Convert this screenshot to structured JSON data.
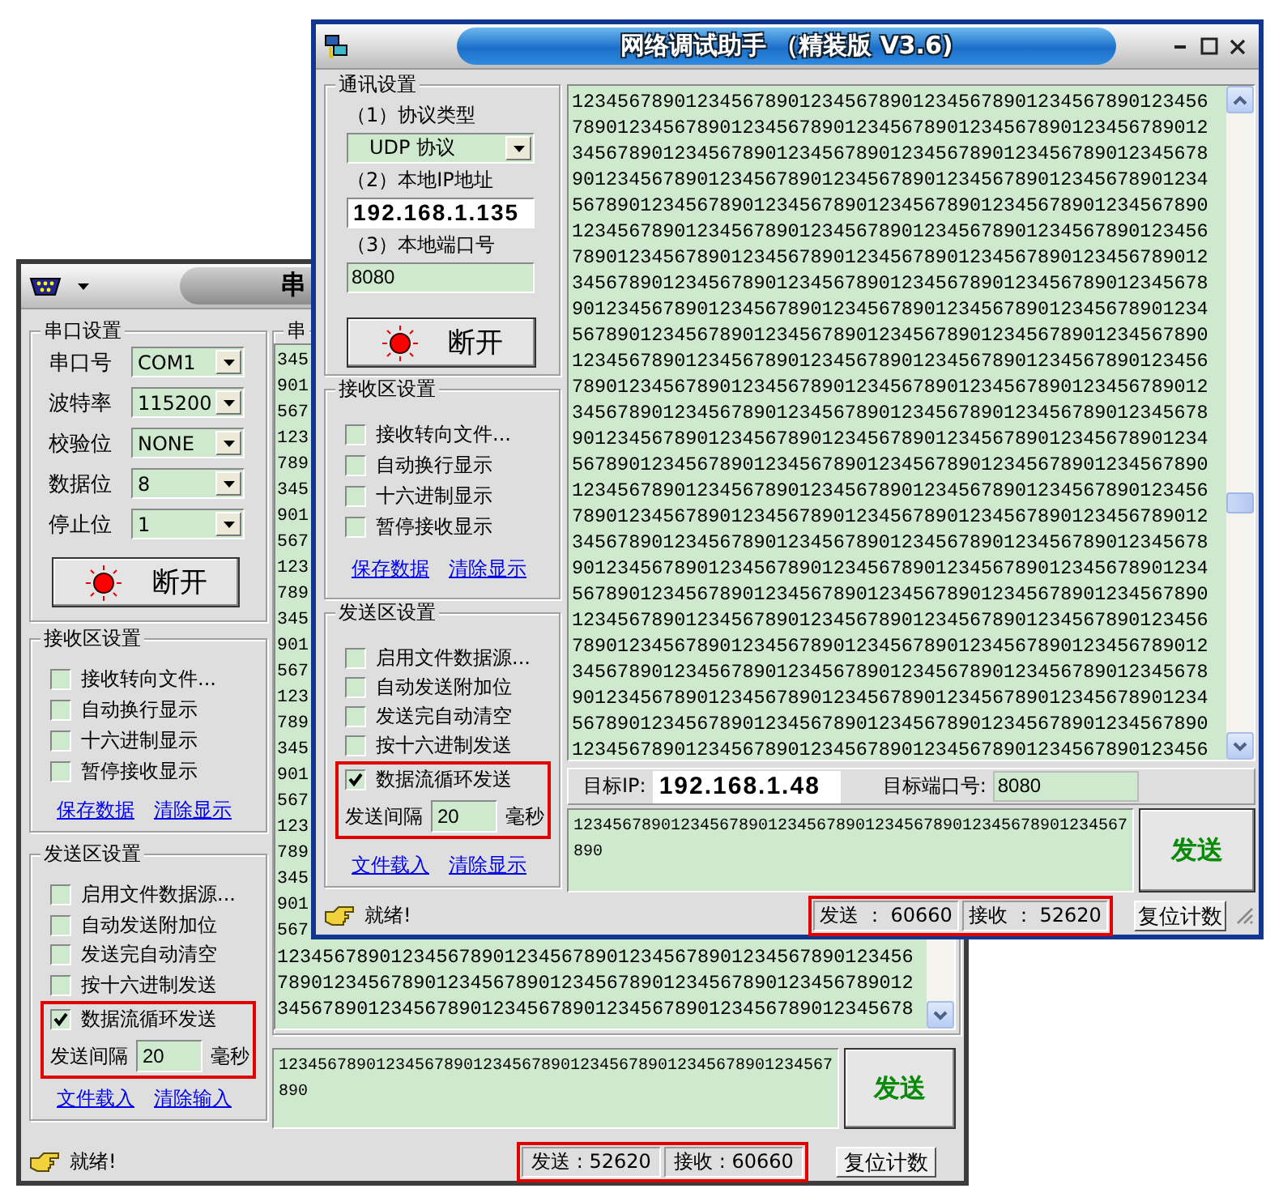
{
  "serial_window": {
    "title": "串",
    "settings_group": {
      "title": "串口设置",
      "items": [
        {
          "kind": "labeled_combo",
          "label": "串口号",
          "value": "COM1"
        },
        {
          "kind": "labeled_combo",
          "label": "波特率",
          "value": "115200"
        },
        {
          "kind": "labeled_combo",
          "label": "校验位",
          "value": "NONE"
        },
        {
          "kind": "labeled_combo",
          "label": "数据位",
          "value": "8"
        },
        {
          "kind": "labeled_combo",
          "label": "停止位",
          "value": "1"
        }
      ],
      "button": "断开"
    },
    "receive_group": {
      "title": "接收区设置",
      "options": [
        {
          "label": "接收转向文件...",
          "checked": false
        },
        {
          "label": "自动换行显示",
          "checked": false
        },
        {
          "label": "十六进制显示",
          "checked": false
        },
        {
          "label": "暂停接收显示",
          "checked": false
        }
      ],
      "links": [
        "保存数据",
        "清除显示"
      ]
    },
    "send_group": {
      "title": "发送区设置",
      "options": [
        {
          "label": "启用文件数据源...",
          "checked": false
        },
        {
          "label": "自动发送附加位",
          "checked": false
        },
        {
          "label": "发送完自动清空",
          "checked": false
        },
        {
          "label": "按十六进制发送",
          "checked": false
        }
      ],
      "loop_box": {
        "highlighted": true,
        "option": {
          "label": "数据流循环发送",
          "checked": true
        },
        "interval": {
          "label": "发送间隔",
          "value": "20",
          "unit": "毫秒"
        }
      },
      "links": [
        "文件载入",
        "清除输入"
      ]
    },
    "receive_panel": {
      "title": "串",
      "clipped_lines": [
        "345",
        "901",
        "567",
        "123",
        "789",
        "345",
        "901",
        "567",
        "123",
        "789",
        "345",
        "901",
        "567",
        "123",
        "789",
        "345",
        "901",
        "567",
        "123",
        "789",
        "345",
        "901",
        "567"
      ],
      "lines": [
        "12345678901234567890123456789012345678901234567890123456",
        "78901234567890123456789012345678901234567890123456789012",
        "34567890123456789012345678901234567890123456789012345678"
      ]
    },
    "send_input": "123456789012345678901234567890123456789012345678901234567890",
    "send_button": "发送",
    "status": "就绪!",
    "counters": {
      "highlighted": true,
      "items": [
        "发送 : 52620",
        "接收 : 60660"
      ]
    },
    "reset_button": "复位计数"
  },
  "network_window": {
    "title": "网络调试助手 （精装版 V3.6)",
    "settings_group": {
      "title": "通讯设置",
      "items": [
        {
          "kind": "caption",
          "text": "（1）协议类型"
        },
        {
          "kind": "combo",
          "value": "UDP 协议"
        },
        {
          "kind": "caption",
          "text": "（2）本地IP地址"
        },
        {
          "kind": "ip",
          "value": "192.168.1.135"
        },
        {
          "kind": "caption",
          "text": "（3）本地端口号"
        },
        {
          "kind": "field",
          "value": "8080"
        }
      ],
      "button": "断开"
    },
    "receive_group": {
      "title": "接收区设置",
      "options": [
        {
          "label": "接收转向文件...",
          "checked": false
        },
        {
          "label": "自动换行显示",
          "checked": false
        },
        {
          "label": "十六进制显示",
          "checked": false
        },
        {
          "label": "暂停接收显示",
          "checked": false
        }
      ],
      "links": [
        "保存数据",
        "清除显示"
      ]
    },
    "send_group": {
      "title": "发送区设置",
      "options": [
        {
          "label": "启用文件数据源...",
          "checked": false
        },
        {
          "label": "自动发送附加位",
          "checked": false
        },
        {
          "label": "发送完自动清空",
          "checked": false
        },
        {
          "label": "按十六进制发送",
          "checked": false
        }
      ],
      "loop_box": {
        "highlighted": true,
        "option": {
          "label": "数据流循环发送",
          "checked": true
        },
        "interval": {
          "label": "发送间隔",
          "value": "20",
          "unit": "毫秒"
        }
      },
      "links": [
        "文件载入",
        "清除显示"
      ]
    },
    "receive_panel": {
      "lines": [
        "12345678901234567890123456789012345678901234567890123456",
        "78901234567890123456789012345678901234567890123456789012",
        "34567890123456789012345678901234567890123456789012345678",
        "90123456789012345678901234567890123456789012345678901234",
        "56789012345678901234567890123456789012345678901234567890",
        "12345678901234567890123456789012345678901234567890123456",
        "78901234567890123456789012345678901234567890123456789012",
        "34567890123456789012345678901234567890123456789012345678",
        "90123456789012345678901234567890123456789012345678901234",
        "56789012345678901234567890123456789012345678901234567890",
        "12345678901234567890123456789012345678901234567890123456",
        "78901234567890123456789012345678901234567890123456789012",
        "34567890123456789012345678901234567890123456789012345678",
        "90123456789012345678901234567890123456789012345678901234",
        "56789012345678901234567890123456789012345678901234567890",
        "12345678901234567890123456789012345678901234567890123456",
        "78901234567890123456789012345678901234567890123456789012",
        "34567890123456789012345678901234567890123456789012345678",
        "90123456789012345678901234567890123456789012345678901234",
        "56789012345678901234567890123456789012345678901234567890",
        "12345678901234567890123456789012345678901234567890123456",
        "78901234567890123456789012345678901234567890123456789012",
        "34567890123456789012345678901234567890123456789012345678",
        "90123456789012345678901234567890123456789012345678901234",
        "56789012345678901234567890123456789012345678901234567890",
        "12345678901234567890123456789012345678901234567890123456"
      ]
    },
    "target": {
      "ip_label": "目标IP:",
      "ip": "192.168.1.48",
      "port_label": "目标端口号:",
      "port": "8080"
    },
    "send_input": "123456789012345678901234567890123456789012345678901234567890",
    "send_button": "发送",
    "status": "就绪!",
    "counters": {
      "highlighted": true,
      "items": [
        "发送 ： 60660",
        "接收 ： 52620"
      ]
    },
    "reset_button": "复位计数"
  }
}
